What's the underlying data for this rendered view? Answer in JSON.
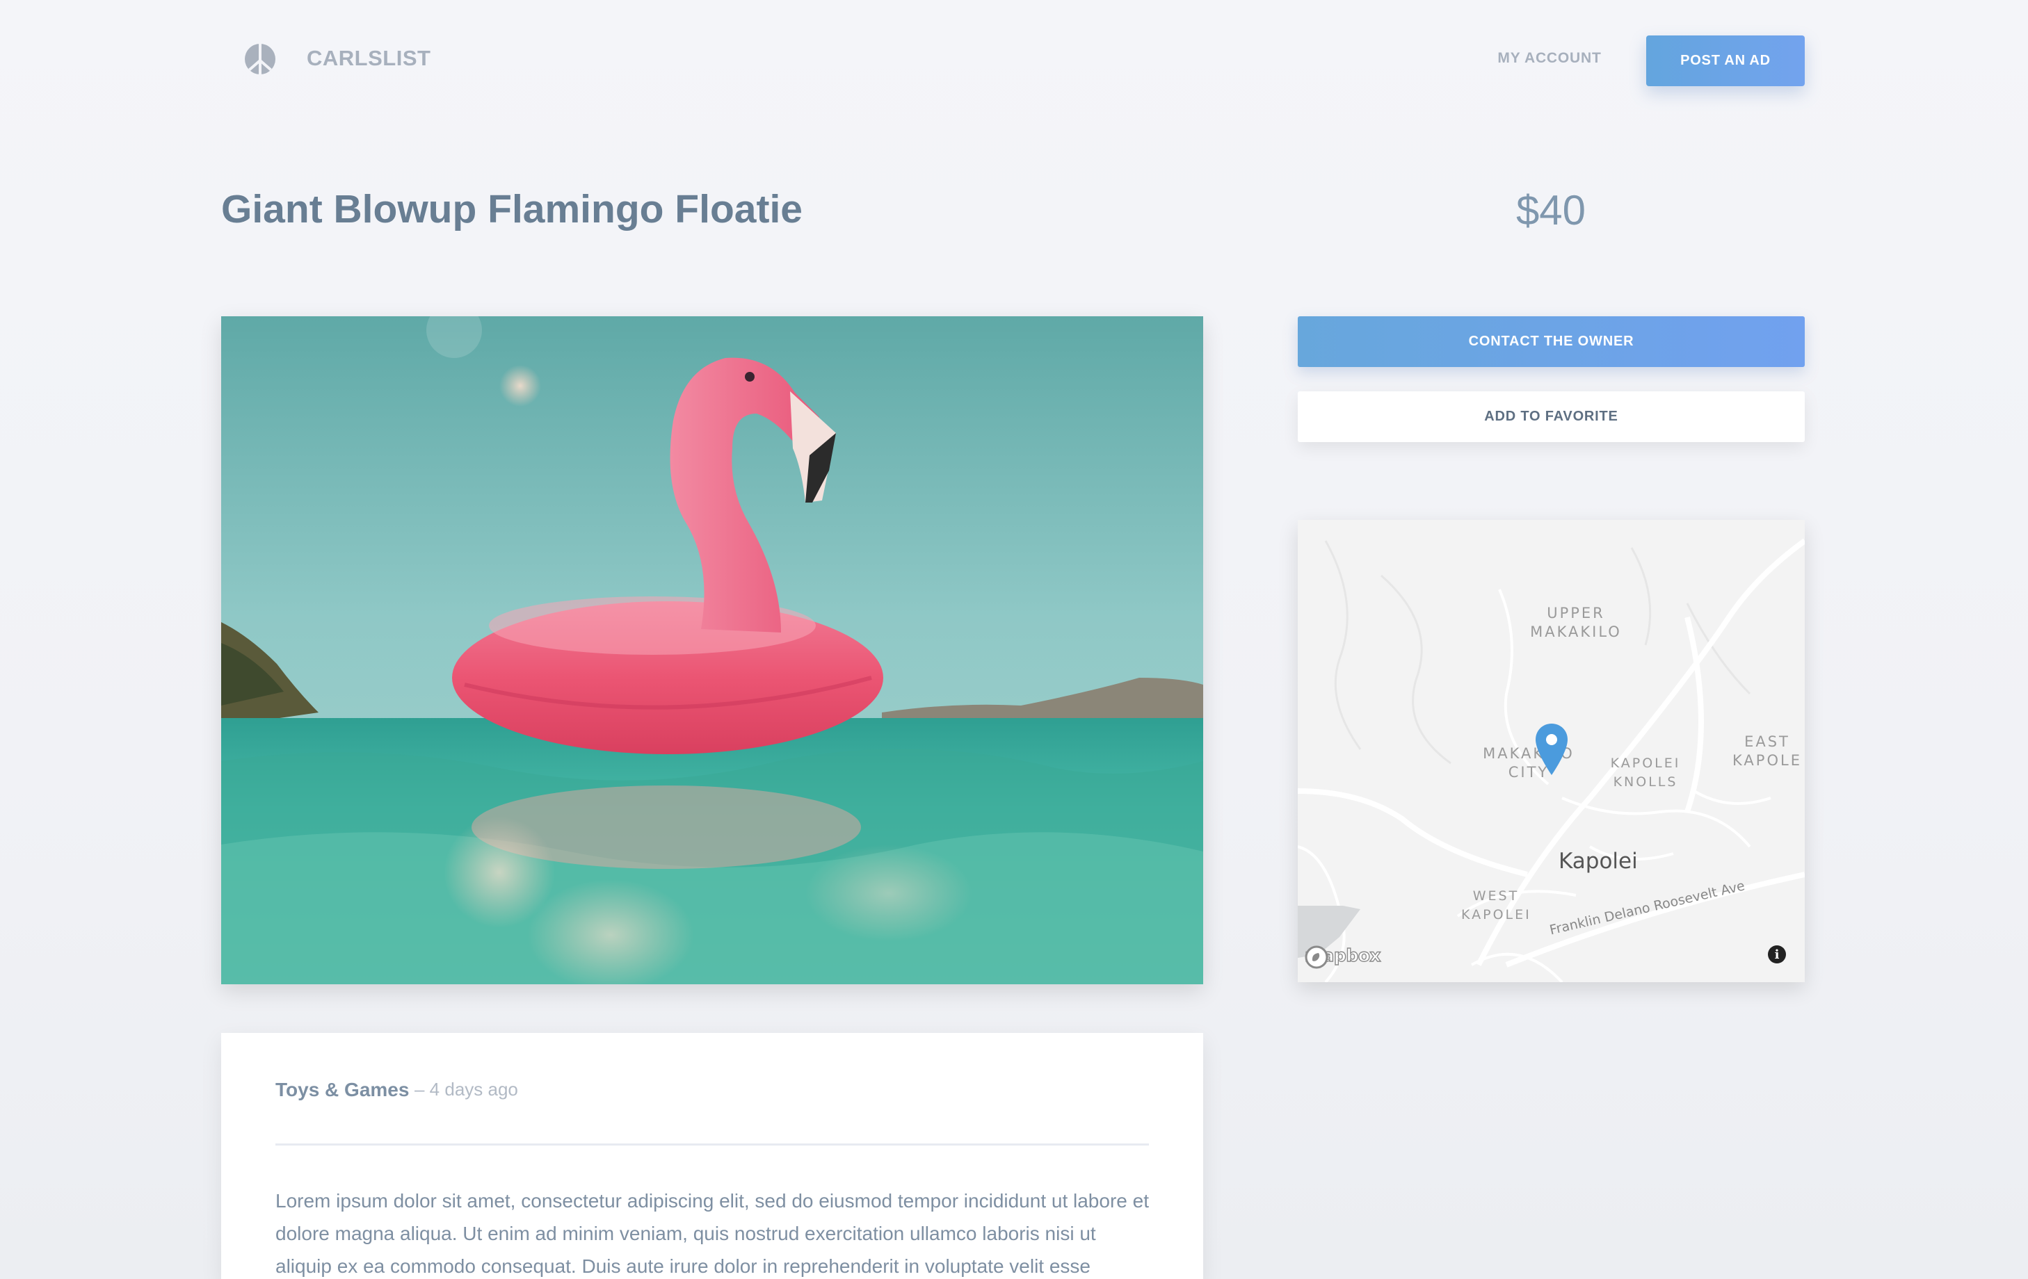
{
  "header": {
    "logo_icon": "peace-icon",
    "brand": "CARLSLIST",
    "my_account": "MY ACCOUNT",
    "post_ad": "POST AN AD"
  },
  "listing": {
    "title": "Giant Blowup Flamingo Floatie",
    "price": "$40",
    "category": "Toys & Games",
    "posted": "– 4 days ago",
    "description": "Lorem ipsum dolor sit amet, consectetur adipiscing elit, sed do eiusmod tempor incididunt ut labore et dolore magna aliqua. Ut enim ad minim veniam, quis nostrud exercitation ullamco laboris nisi ut aliquip ex ea commodo consequat. Duis aute irure dolor in reprehenderit in voluptate velit esse"
  },
  "actions": {
    "contact": "CONTACT THE OWNER",
    "favorite": "ADD TO FAVORITE"
  },
  "map": {
    "labels": {
      "upper_makakilo": "UPPER\nMAKAKILO",
      "makakilo_city": "MAKAKILO\nCITY",
      "kapolei_knolls": "KAPOLEI\nKNOLLS",
      "east_kapolei": "EAST\nKAPOLE",
      "west_kapolei": "WEST\nKAPOLEI",
      "city": "Kapolei",
      "road": "Franklin Delano Roosevelt Ave"
    },
    "attribution": "mapbox",
    "pin_icon": "map-pin-icon",
    "info_icon": "i"
  },
  "colors": {
    "accent_start": "#63a5de",
    "accent_end": "#73a3ee",
    "title": "#687e93",
    "flamingo": "#ef5d7d",
    "water": "#3fb4a6"
  }
}
